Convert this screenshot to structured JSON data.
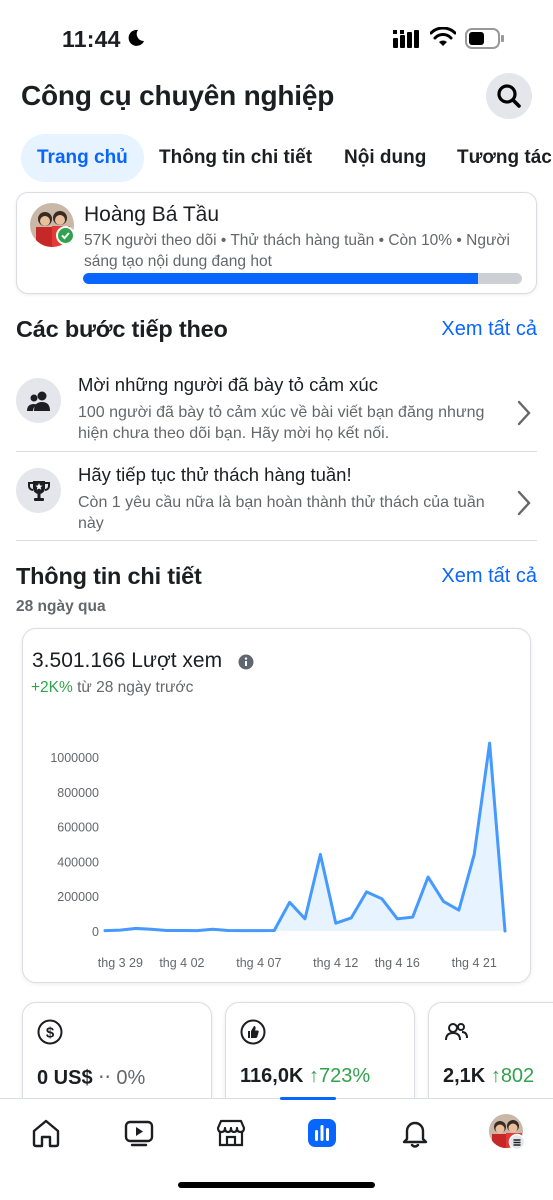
{
  "status_bar": {
    "time": "11:44"
  },
  "header": {
    "title": "Công cụ chuyên nghiệp"
  },
  "tabs": [
    {
      "label": "Trang chủ",
      "active": true
    },
    {
      "label": "Thông tin chi tiết",
      "active": false
    },
    {
      "label": "Nội dung",
      "active": false
    },
    {
      "label": "Tương tác",
      "active": false
    }
  ],
  "profile": {
    "name": "Hoàng Bá Tầu",
    "meta": "57K người theo dõi • Thử thách hàng tuần • Còn 10% • Người sáng tạo nội dung đang hot",
    "progress_percent": 90
  },
  "next_steps": {
    "title": "Các bước tiếp theo",
    "see_all": "Xem tất cả",
    "items": [
      {
        "icon": "people-icon",
        "title": "Mời những người đã bày tỏ cảm xúc",
        "desc": "100 người đã bày tỏ cảm xúc về bài viết bạn đăng nhưng hiện chưa theo dõi bạn. Hãy mời họ kết nối."
      },
      {
        "icon": "trophy-icon",
        "title": "Hãy tiếp tục thử thách hàng tuần!",
        "desc": "Còn 1 yêu cầu nữa là bạn hoàn thành thử thách của tuần này"
      }
    ]
  },
  "insights": {
    "title": "Thông tin chi tiết",
    "see_all": "Xem tất cả",
    "period": "28 ngày qua",
    "views_value": "3.501.166 Lượt xem",
    "change_value": "+2K%",
    "change_text": " từ 28 ngày trước"
  },
  "chart_data": {
    "type": "area",
    "title": "",
    "xlabel": "",
    "ylabel": "",
    "ylim": [
      0,
      1000000
    ],
    "y_ticks": [
      0,
      200000,
      400000,
      600000,
      800000,
      1000000
    ],
    "y_tick_labels": [
      "0",
      "200000",
      "400000",
      "600000",
      "800000",
      "1000000"
    ],
    "x_tick_labels": [
      "thg 3 29",
      "thg 4 02",
      "thg 4 07",
      "thg 4 12",
      "thg 4 16",
      "thg 4 21"
    ],
    "x_tick_index": [
      1,
      5,
      10,
      15,
      19,
      24
    ],
    "values": [
      2000,
      5000,
      15000,
      10000,
      3000,
      3000,
      2000,
      10000,
      3000,
      2000,
      2000,
      3000,
      165000,
      70000,
      440000,
      45000,
      75000,
      225000,
      185000,
      70000,
      80000,
      310000,
      170000,
      120000,
      440000,
      1080000,
      0
    ],
    "color": "#4599ff",
    "fill": "#e7f3ff"
  },
  "stats": [
    {
      "icon": "dollar-icon",
      "value": "0 US$",
      "change": "‧‧ 0%",
      "trend": "flat"
    },
    {
      "icon": "like-icon",
      "value": "116,0K",
      "change": "↑723%",
      "trend": "up"
    },
    {
      "icon": "followers-icon",
      "value": "2,1K",
      "change": "↑802",
      "trend": "up"
    }
  ],
  "bottom_nav": [
    {
      "icon": "home-icon",
      "active": false
    },
    {
      "icon": "video-icon",
      "active": false
    },
    {
      "icon": "marketplace-icon",
      "active": false
    },
    {
      "icon": "dashboard-icon",
      "active": true
    },
    {
      "icon": "bell-icon",
      "active": false
    },
    {
      "icon": "profile-avatar-icon",
      "active": false
    }
  ]
}
